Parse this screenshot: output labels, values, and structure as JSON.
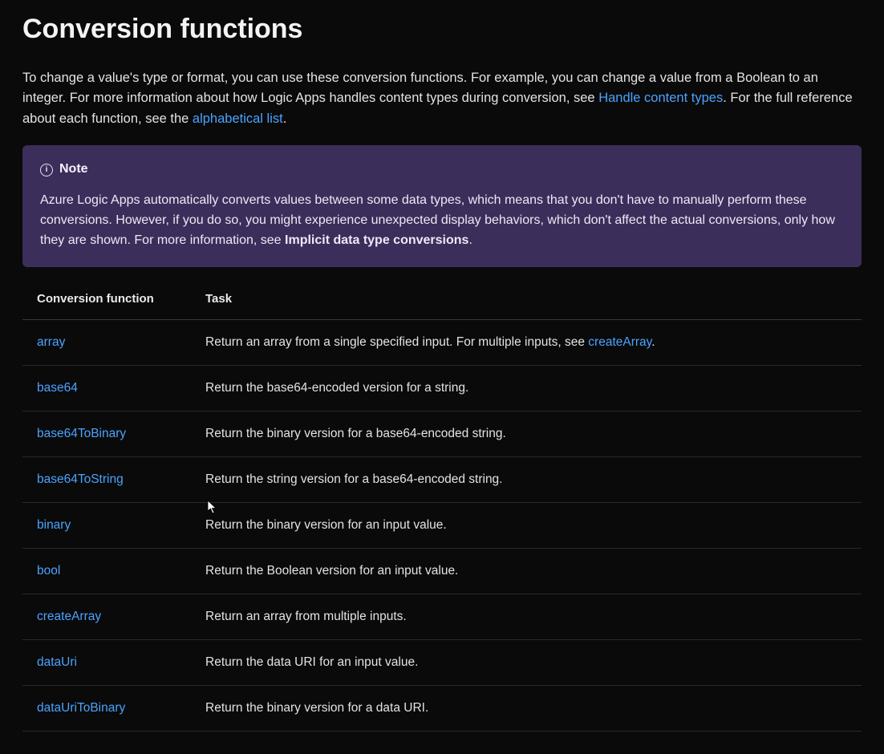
{
  "heading": "Conversion functions",
  "intro": {
    "part1": "To change a value's type or format, you can use these conversion functions. For example, you can change a value from a Boolean to an integer. For more information about how Logic Apps handles content types during conversion, see ",
    "link1": "Handle content types",
    "part2": ". For the full reference about each function, see the ",
    "link2": "alphabetical list",
    "part3": "."
  },
  "note": {
    "title": "Note",
    "body_part1": "Azure Logic Apps automatically converts values between some data types, which means that you don't have to manually perform these conversions. However, if you do so, you might experience unexpected display behaviors, which don't affect the actual conversions, only how they are shown. For more information, see ",
    "body_strong": "Implicit data type conversions",
    "body_part2": "."
  },
  "table": {
    "headers": {
      "col1": "Conversion function",
      "col2": "Task"
    },
    "rows": [
      {
        "func": "array",
        "task_prefix": "Return an array from a single specified input. For multiple inputs, see ",
        "task_link": "createArray",
        "task_suffix": "."
      },
      {
        "func": "base64",
        "task": "Return the base64-encoded version for a string."
      },
      {
        "func": "base64ToBinary",
        "task": "Return the binary version for a base64-encoded string."
      },
      {
        "func": "base64ToString",
        "task": "Return the string version for a base64-encoded string."
      },
      {
        "func": "binary",
        "task": "Return the binary version for an input value."
      },
      {
        "func": "bool",
        "task": "Return the Boolean version for an input value."
      },
      {
        "func": "createArray",
        "task": "Return an array from multiple inputs."
      },
      {
        "func": "dataUri",
        "task": "Return the data URI for an input value."
      },
      {
        "func": "dataUriToBinary",
        "task": "Return the binary version for a data URI."
      }
    ]
  }
}
